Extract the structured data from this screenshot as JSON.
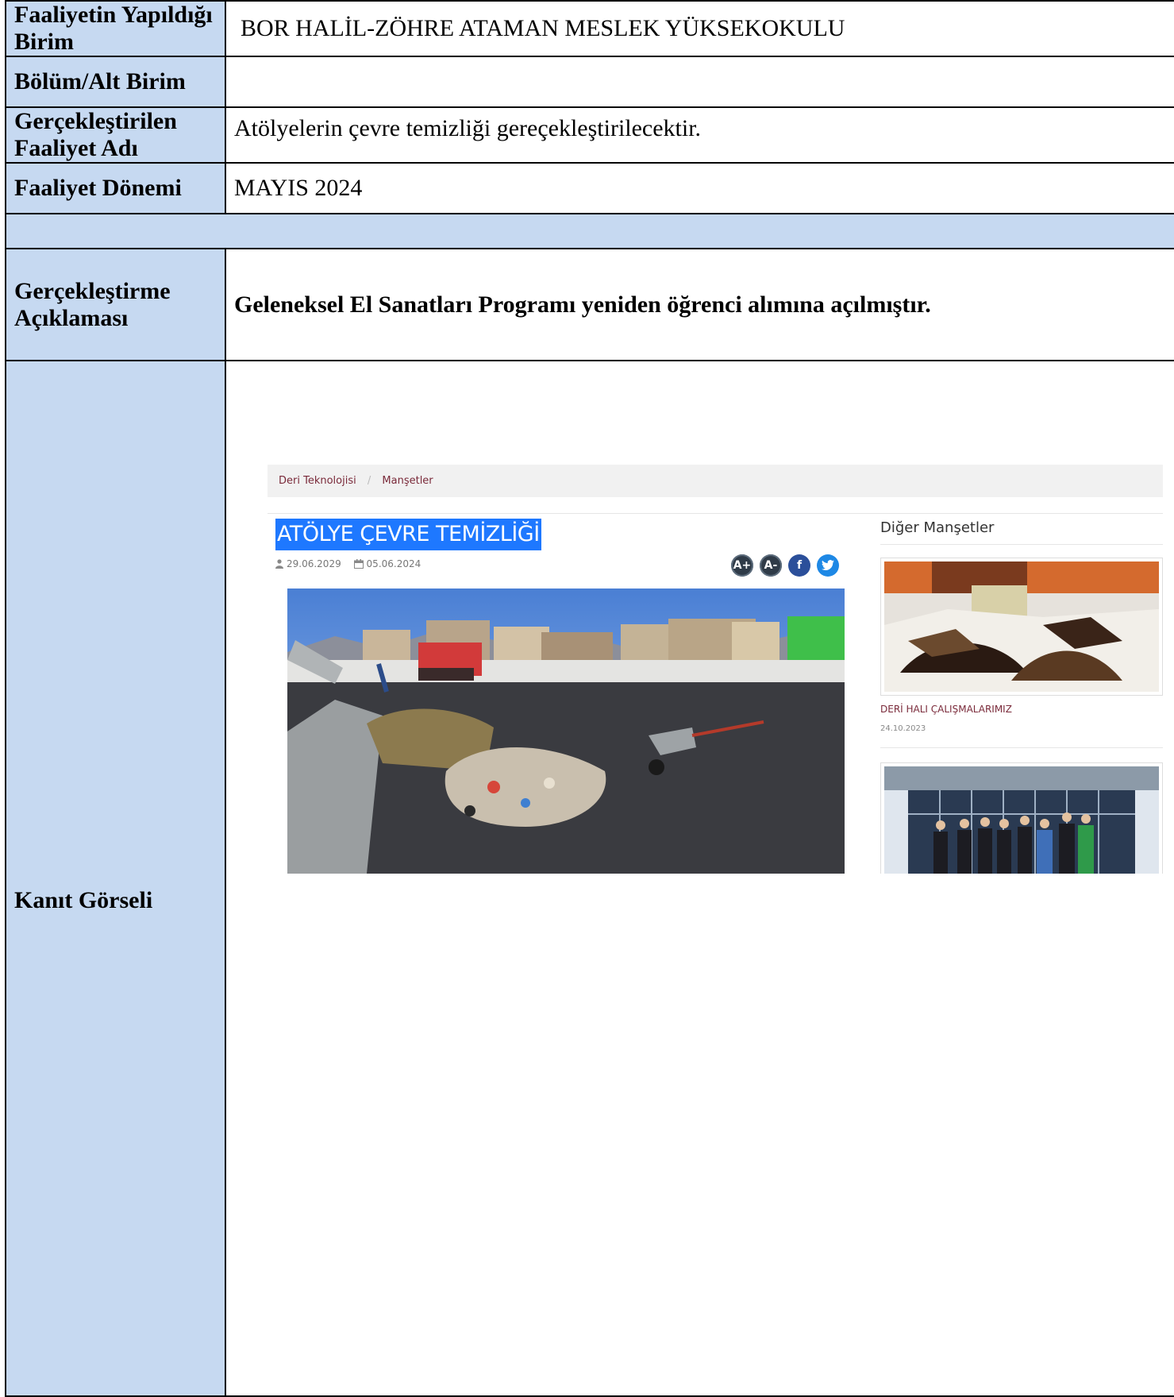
{
  "form": {
    "rows": [
      {
        "label": "Faaliyetin Yapıldığı Birim",
        "value": "BOR HALİL-ZÖHRE ATAMAN MESLEK YÜKSEKOKULU"
      },
      {
        "label": "Bölüm/Alt Birim",
        "value": ""
      },
      {
        "label": "Gerçekleştirilen Faaliyet Adı",
        "value": "Atölyelerin çevre temizliği gereçekleştirilecektir."
      },
      {
        "label": "Faaliyet Dönemi",
        "value": "MAYIS 2024"
      },
      {
        "label": "Gerçekleştirme Açıklaması",
        "value": "Geleneksel El Sanatları Programı yeniden öğrenci alımına açılmıştır."
      },
      {
        "label": "Kanıt Görseli",
        "value": ""
      }
    ]
  },
  "evidence": {
    "breadcrumb": {
      "item1": "Deri Teknolojisi",
      "separator": "/",
      "item2": "Manşetler"
    },
    "article": {
      "title": "ATÖLYE ÇEVRE TEMİZLİĞİ",
      "date_created": "29.06.2029",
      "date_published": "05.06.2024",
      "icons": [
        "user-icon",
        "calendar-icon"
      ]
    },
    "social": {
      "font_up": "A+",
      "font_down": "A-",
      "facebook": "f",
      "twitter_icon": "twitter-icon"
    },
    "sidebar": {
      "heading": "Diğer Manşetler",
      "items": [
        {
          "title": "DERİ HALI ÇALIŞMALARIMIZ",
          "date": "24.10.2023"
        }
      ]
    },
    "colors": {
      "title_highlight": "#1e78ff",
      "link": "#7a2a3a",
      "label_bg": "#c6d9f1"
    }
  }
}
